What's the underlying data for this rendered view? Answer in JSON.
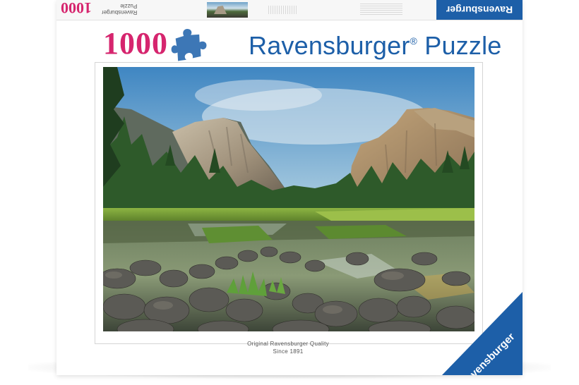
{
  "box_top": {
    "count": "1000",
    "brand_vertical": "Ravensburger",
    "type_vertical": "Puzzle",
    "logo": "Ravensburger"
  },
  "front": {
    "piece_count": "1000",
    "brand": "Ravensburger",
    "trademark": "®",
    "product": "Puzzle",
    "quality_line1": "Original Ravensburger Quality",
    "quality_line2": "Since 1891",
    "corner_logo": "Ravensburger"
  },
  "colors": {
    "count_pink": "#d6256e",
    "brand_blue": "#1d5fa8",
    "piece_blue": "#3d77b6"
  },
  "icons": {
    "puzzle_piece": "puzzle-piece-icon"
  }
}
